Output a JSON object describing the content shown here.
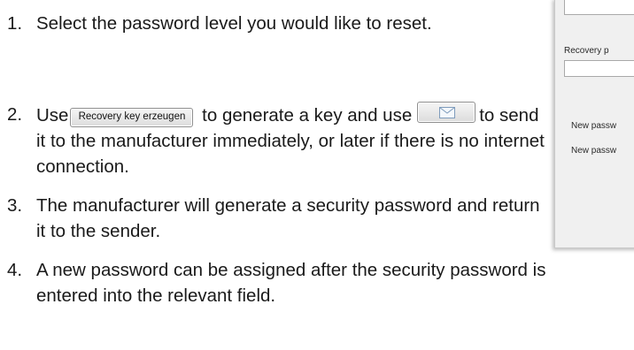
{
  "steps": [
    {
      "number": "1.",
      "text": "Select the password level you would like to reset."
    },
    {
      "number": "2.",
      "text_before": "Use",
      "text_middle": "to generate a key and use",
      "text_after": "to send it to the manufacturer immediately, or later if there is no internet connection."
    },
    {
      "number": "3.",
      "text": "The manufacturer will generate a security password and return it to the sender."
    },
    {
      "number": "4.",
      "text": "A new password can be assigned after the security password is entered into the relevant field."
    }
  ],
  "inline_buttons": {
    "recovery_key_label": "Recovery key erzeugen",
    "send_mail_icon": "envelope-icon"
  },
  "dialog": {
    "recovery_label": "Recovery p",
    "new_password_label_1": "New passw",
    "new_password_label_2": "New passw"
  }
}
